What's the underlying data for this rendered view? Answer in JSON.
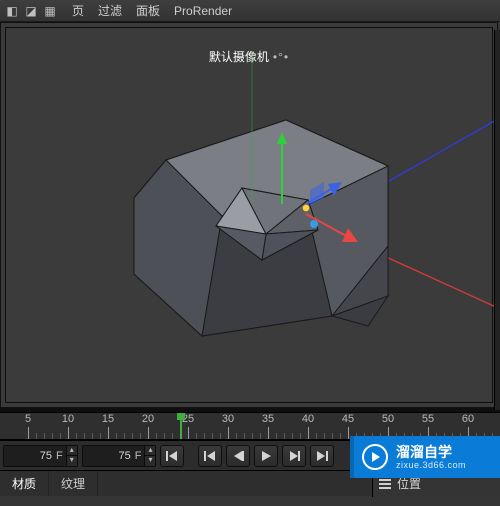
{
  "menubar": {
    "items": [
      "页",
      "过滤",
      "面板",
      "ProRender"
    ]
  },
  "viewport": {
    "camera_label": "默认摄像机"
  },
  "ruler": {
    "labels": [
      5,
      10,
      15,
      20,
      25,
      30,
      35,
      40,
      45,
      50,
      55,
      60
    ],
    "start": 0,
    "spacing_major": 38,
    "playhead_frame": 24
  },
  "transport": {
    "start_field": {
      "value": "75",
      "unit": "F"
    },
    "end_field": {
      "value": "75",
      "unit": "F"
    }
  },
  "watermark": {
    "title": "溜溜自学",
    "subtitle": "zixue.3d66.com"
  },
  "bottom_tabs": [
    "材质",
    "纹理"
  ],
  "panel_head": {
    "label": "位置"
  }
}
